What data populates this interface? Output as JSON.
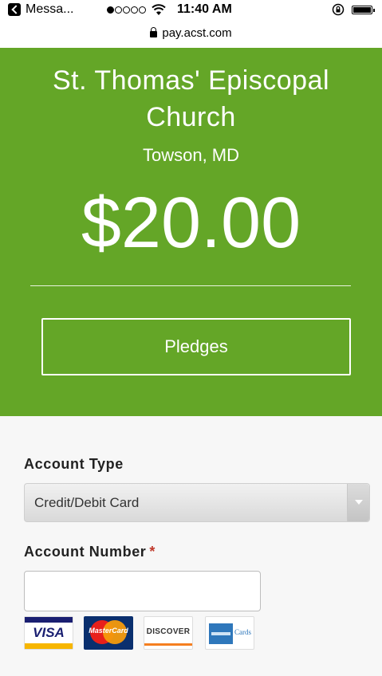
{
  "status_bar": {
    "app": "Messa...",
    "time": "11:40 AM",
    "signal_bars_filled": 1,
    "signal_bars_total": 5
  },
  "browser": {
    "url": "pay.acst.com"
  },
  "hero": {
    "org_name": "St. Thomas' Episcopal Church",
    "location": "Towson, MD",
    "amount": "$20.00",
    "fund_button": "Pledges",
    "background_color": "#64a627"
  },
  "form": {
    "account_type_label": "Account Type",
    "account_type_selected": "Credit/Debit Card",
    "account_number_label": "Account Number",
    "required_marker": "*",
    "account_number_value": "",
    "cards": [
      {
        "name": "visa",
        "label": "VISA"
      },
      {
        "name": "mastercard",
        "label": "MasterCard"
      },
      {
        "name": "discover",
        "label": "DISCOVER"
      },
      {
        "name": "american-express",
        "label": "Cards"
      }
    ]
  }
}
